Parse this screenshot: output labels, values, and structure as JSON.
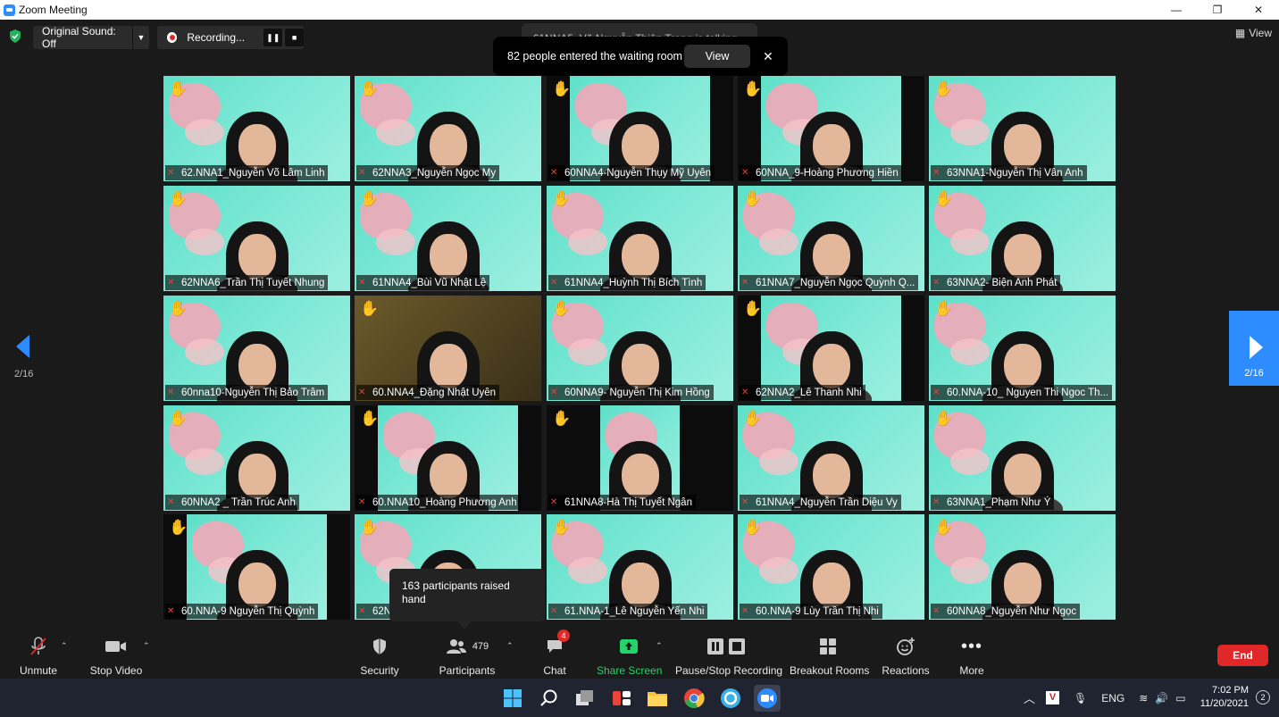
{
  "window": {
    "title": "Zoom Meeting",
    "minimize": "—",
    "maximize": "❐",
    "close": "✕"
  },
  "topbar": {
    "original_sound": "Original Sound: Off",
    "recording": "Recording...",
    "view": "View"
  },
  "talking": "61NNA5_Võ Nguyễn Thiên Trang is talking...",
  "waiting_room": {
    "message": "82 people entered the waiting room",
    "view": "View"
  },
  "pager": {
    "left": "2/16",
    "right": "2/16"
  },
  "tooltip": "163 participants raised hand",
  "participants": [
    {
      "name": "62.NNA1_Nguyễn Võ Lâm Linh",
      "hand": "✋"
    },
    {
      "name": "62NNA3_Nguyễn Ngọc My",
      "hand": "✋"
    },
    {
      "name": "60NNA4-Nguyễn Thụy Mỹ Uyên",
      "hand": "✋"
    },
    {
      "name": "60NNA_9-Hoàng Phương Hiền",
      "hand": "✋"
    },
    {
      "name": "63NNA1-Nguyễn Thị Vân Anh",
      "hand": "✋"
    },
    {
      "name": "62NNA6_Trần Thị Tuyết Nhung",
      "hand": "✋"
    },
    {
      "name": "61NNA4_Bùi Vũ Nhật Lệ",
      "hand": "✋"
    },
    {
      "name": "61NNA4_Huỳnh Thị Bích Tình",
      "hand": "✋"
    },
    {
      "name": "61NNA7_Nguyễn Ngọc Quỳnh Q...",
      "hand": "✋"
    },
    {
      "name": "63NNA2- Biện Anh Phát",
      "hand": "✋"
    },
    {
      "name": "60nna10-Nguyễn Thị Bảo Trâm",
      "hand": "✋"
    },
    {
      "name": "60.NNA4_Đặng Nhật Uyên",
      "hand": "✋"
    },
    {
      "name": "60NNA9- Nguyễn Thị Kim Hồng",
      "hand": "✋"
    },
    {
      "name": "62NNA2_Lê Thanh Nhi",
      "hand": "✋"
    },
    {
      "name": "60.NNA-10_ Nguyen Thi Ngoc Th...",
      "hand": "✋"
    },
    {
      "name": "60NNA2 _ Trần Trúc Anh",
      "hand": "✋"
    },
    {
      "name": "60.NNA10_Hoàng Phương Anh",
      "hand": "✋"
    },
    {
      "name": "61NNA8-Hà Thị Tuyết Ngân",
      "hand": "✋"
    },
    {
      "name": "61NNA4_Nguyễn Trần Diệu Vy",
      "hand": "✋"
    },
    {
      "name": "63NNA1_Phạm Như Ý",
      "hand": "✋"
    },
    {
      "name": "60.NNA-9 Nguyễn Thị Quỳnh",
      "hand": "✋"
    },
    {
      "name": "62N",
      "hand": "✋"
    },
    {
      "name": "61.NNA-1_Lê Nguyễn Yến Nhi",
      "hand": "✋"
    },
    {
      "name": "60.NNA-9 Lùy Trần Thị Nhi",
      "hand": "✋"
    },
    {
      "name": "60NNA8_Nguyễn Như Ngọc",
      "hand": "✋"
    }
  ],
  "toolbar": {
    "unmute": "Unmute",
    "stop_video": "Stop Video",
    "security": "Security",
    "participants": "Participants",
    "participants_count": "479",
    "chat": "Chat",
    "chat_badge": "4",
    "share_screen": "Share Screen",
    "recording": "Pause/Stop Recording",
    "breakout": "Breakout Rooms",
    "reactions": "Reactions",
    "more": "More",
    "end": "End"
  },
  "taskbar": {
    "lang": "ENG",
    "time": "7:02 PM",
    "date": "11/20/2021",
    "notifications": "2"
  }
}
